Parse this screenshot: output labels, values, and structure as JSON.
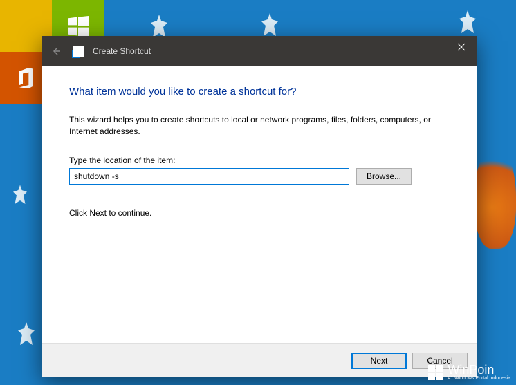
{
  "titlebar": {
    "title": "Create Shortcut"
  },
  "content": {
    "heading": "What item would you like to create a shortcut for?",
    "description": "This wizard helps you to create shortcuts to local or network programs, files, folders, computers, or Internet addresses.",
    "location_label": "Type the location of the item:",
    "location_value": "shutdown -s",
    "browse_label": "Browse...",
    "continue_text": "Click Next to continue."
  },
  "footer": {
    "next_label": "Next",
    "cancel_label": "Cancel"
  },
  "watermark": {
    "title": "WinPoin",
    "subtitle": "#1 Windows Portal Indonesia"
  }
}
